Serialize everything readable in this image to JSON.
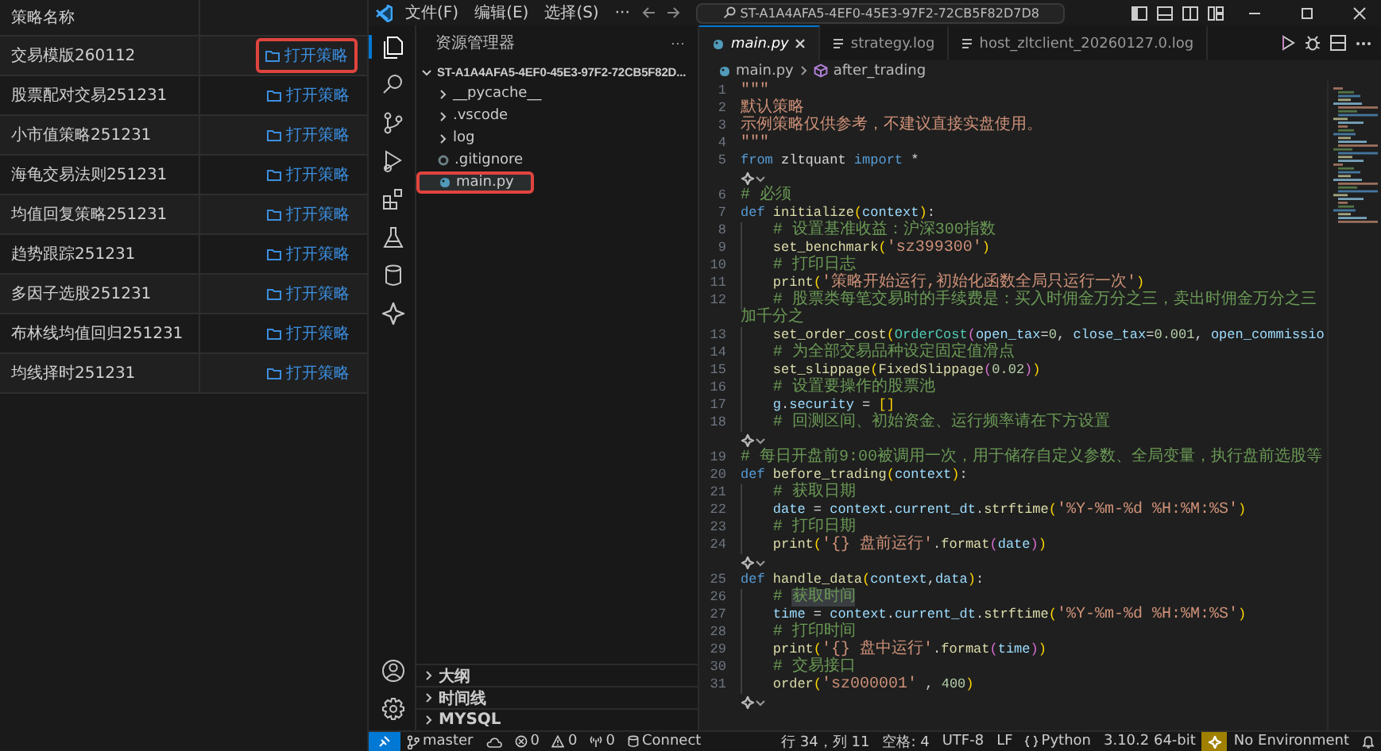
{
  "strategy_list": {
    "header": "策略名称",
    "rows": [
      {
        "name": "交易模版260112",
        "action": "打开策略",
        "highlighted": true
      },
      {
        "name": "股票配对交易251231",
        "action": "打开策略",
        "highlighted": false
      },
      {
        "name": "小市值策略251231",
        "action": "打开策略",
        "highlighted": false
      },
      {
        "name": "海龟交易法则251231",
        "action": "打开策略",
        "highlighted": false
      },
      {
        "name": "均值回复策略251231",
        "action": "打开策略",
        "highlighted": false
      },
      {
        "name": "趋势跟踪251231",
        "action": "打开策略",
        "highlighted": false
      },
      {
        "name": "多因子选股251231",
        "action": "打开策略",
        "highlighted": false
      },
      {
        "name": "布林线均值回归251231",
        "action": "打开策略",
        "highlighted": false
      },
      {
        "name": "均线择时251231",
        "action": "打开策略",
        "highlighted": false
      }
    ]
  },
  "title_bar": {
    "menus": [
      "文件(F)",
      "编辑(E)",
      "选择(S)",
      "···"
    ],
    "search": "ST-A1A4AFA5-4EF0-45E3-97F2-72CB5F82D7D8"
  },
  "activity_bar": [
    {
      "kind": "files",
      "selected": true
    },
    {
      "kind": "search",
      "selected": false
    },
    {
      "kind": "scm",
      "selected": false
    },
    {
      "kind": "debug",
      "selected": false
    },
    {
      "kind": "extensions",
      "selected": false
    },
    {
      "kind": "testing",
      "selected": false
    },
    {
      "kind": "database",
      "selected": false
    },
    {
      "kind": "star",
      "selected": false
    },
    {
      "kind": "account",
      "selected": false
    },
    {
      "kind": "settings",
      "selected": false
    }
  ],
  "explorer": {
    "title": "资源管理器",
    "more": "···",
    "root": {
      "label": "ST-A1A4AFA5-4EF0-45E3-97F2-72CB5F82D...",
      "expanded": true,
      "children": [
        {
          "kind": "folder",
          "label": "__pycache__",
          "expanded": false,
          "selected": false,
          "highlighted": false
        },
        {
          "kind": "folder",
          "label": ".vscode",
          "expanded": false,
          "selected": false,
          "highlighted": false
        },
        {
          "kind": "folder",
          "label": "log",
          "expanded": false,
          "selected": false,
          "highlighted": false
        },
        {
          "kind": "file",
          "label": ".gitignore",
          "selected": false,
          "highlighted": false
        },
        {
          "kind": "file",
          "label": "main.py",
          "selected": true,
          "highlighted": true
        }
      ]
    },
    "sections": [
      {
        "label": "大纲",
        "expanded": false
      },
      {
        "label": "时间线",
        "expanded": false
      },
      {
        "label": "MYSQL",
        "expanded": false
      }
    ]
  },
  "tabs": [
    {
      "label": "main.py",
      "selected": true,
      "kind": "python"
    },
    {
      "label": "strategy.log",
      "selected": false,
      "kind": "log"
    },
    {
      "label": "host_zltclient_20260127.0.log",
      "selected": false,
      "kind": "log"
    }
  ],
  "breadcrumb": [
    "main.py",
    "after_trading"
  ],
  "code": [
    {
      "number": "1",
      "indented": false,
      "tokens": [
        {
          "kind": "str",
          "text": "\"\"\""
        }
      ]
    },
    {
      "number": "2",
      "indented": false,
      "tokens": [
        {
          "kind": "str",
          "text": "默认策略"
        }
      ]
    },
    {
      "number": "3",
      "indented": false,
      "tokens": [
        {
          "kind": "str",
          "text": "示例策略仅供参考，不建议直接实盘使用。"
        }
      ]
    },
    {
      "number": "4",
      "indented": false,
      "tokens": [
        {
          "kind": "str",
          "text": "\"\"\""
        }
      ]
    },
    {
      "number": "5",
      "indented": false,
      "tokens": [
        {
          "kind": "kw",
          "text": "from"
        },
        {
          "kind": "plain",
          "text": " zltquant "
        },
        {
          "kind": "kw",
          "text": "import"
        },
        {
          "kind": "plain",
          "text": " *"
        }
      ]
    },
    {
      "kind": "lens"
    },
    {
      "number": "6",
      "indented": false,
      "tokens": [
        {
          "kind": "cm",
          "text": "# 必须"
        }
      ]
    },
    {
      "number": "7",
      "indented": false,
      "tokens": [
        {
          "kind": "kw",
          "text": "def "
        },
        {
          "kind": "fn",
          "text": "initialize"
        },
        {
          "kind": "br1",
          "text": "("
        },
        {
          "kind": "param",
          "text": "context"
        },
        {
          "kind": "br1",
          "text": ")"
        },
        {
          "kind": "plain",
          "text": ":"
        }
      ]
    },
    {
      "number": "8",
      "indented": true,
      "tokens": [
        {
          "kind": "cm",
          "text": "# 设置基准收益：沪深300指数"
        }
      ]
    },
    {
      "number": "9",
      "indented": true,
      "tokens": [
        {
          "kind": "fn",
          "text": "set_benchmark"
        },
        {
          "kind": "br1",
          "text": "("
        },
        {
          "kind": "str",
          "text": "'sz399300'"
        },
        {
          "kind": "br1",
          "text": ")"
        }
      ]
    },
    {
      "number": "10",
      "indented": true,
      "tokens": [
        {
          "kind": "cm",
          "text": "# 打印日志"
        }
      ]
    },
    {
      "number": "11",
      "indented": true,
      "tokens": [
        {
          "kind": "fn",
          "text": "print"
        },
        {
          "kind": "br1",
          "text": "("
        },
        {
          "kind": "str",
          "text": "'策略开始运行,初始化函数全局只运行一次'"
        },
        {
          "kind": "br1",
          "text": ")"
        }
      ]
    },
    {
      "number": "12",
      "indented": true,
      "tokens": [
        {
          "kind": "cm",
          "text": "# 股票类每笔交易时的手续费是：买入时佣金万分之三，卖出时佣金万分之三加千分之"
        }
      ]
    },
    {
      "number": "13",
      "indented": true,
      "tokens": [
        {
          "kind": "fn",
          "text": "set_order_cost"
        },
        {
          "kind": "br1",
          "text": "("
        },
        {
          "kind": "cls",
          "text": "OrderCost"
        },
        {
          "kind": "br2",
          "text": "("
        },
        {
          "kind": "param",
          "text": "open_tax"
        },
        {
          "kind": "plain",
          "text": "="
        },
        {
          "kind": "num",
          "text": "0"
        },
        {
          "kind": "plain",
          "text": ", "
        },
        {
          "kind": "param",
          "text": "close_tax"
        },
        {
          "kind": "plain",
          "text": "="
        },
        {
          "kind": "num",
          "text": "0.001"
        },
        {
          "kind": "plain",
          "text": ", "
        },
        {
          "kind": "param",
          "text": "open_commissio"
        }
      ]
    },
    {
      "number": "14",
      "indented": true,
      "tokens": [
        {
          "kind": "cm",
          "text": "# 为全部交易品种设定固定值滑点"
        }
      ]
    },
    {
      "number": "15",
      "indented": true,
      "tokens": [
        {
          "kind": "fn",
          "text": "set_slippage"
        },
        {
          "kind": "br1",
          "text": "("
        },
        {
          "kind": "fn",
          "text": "FixedSlippage"
        },
        {
          "kind": "br2",
          "text": "("
        },
        {
          "kind": "num",
          "text": "0.02"
        },
        {
          "kind": "br2",
          "text": ")"
        },
        {
          "kind": "br1",
          "text": ")"
        }
      ]
    },
    {
      "number": "16",
      "indented": true,
      "tokens": [
        {
          "kind": "cm",
          "text": "# 设置要操作的股票池"
        }
      ]
    },
    {
      "number": "17",
      "indented": true,
      "tokens": [
        {
          "kind": "var",
          "text": "g"
        },
        {
          "kind": "plain",
          "text": "."
        },
        {
          "kind": "var",
          "text": "security"
        },
        {
          "kind": "plain",
          "text": " = "
        },
        {
          "kind": "br1",
          "text": "[]"
        }
      ]
    },
    {
      "number": "18",
      "indented": true,
      "tokens": [
        {
          "kind": "cm",
          "text": "# 回测区间、初始资金、运行频率请在下方设置"
        }
      ]
    },
    {
      "kind": "lens"
    },
    {
      "number": "19",
      "indented": false,
      "tokens": [
        {
          "kind": "cm",
          "text": "# 每日开盘前9:00被调用一次，用于储存自定义参数、全局变量，执行盘前选股等"
        }
      ]
    },
    {
      "number": "20",
      "indented": false,
      "tokens": [
        {
          "kind": "kw",
          "text": "def "
        },
        {
          "kind": "fn",
          "text": "before_trading"
        },
        {
          "kind": "br1",
          "text": "("
        },
        {
          "kind": "param",
          "text": "context"
        },
        {
          "kind": "br1",
          "text": ")"
        },
        {
          "kind": "plain",
          "text": ":"
        }
      ]
    },
    {
      "number": "21",
      "indented": true,
      "tokens": [
        {
          "kind": "cm",
          "text": "# 获取日期"
        }
      ]
    },
    {
      "number": "22",
      "indented": true,
      "tokens": [
        {
          "kind": "var",
          "text": "date"
        },
        {
          "kind": "plain",
          "text": " = "
        },
        {
          "kind": "var",
          "text": "context"
        },
        {
          "kind": "plain",
          "text": "."
        },
        {
          "kind": "var",
          "text": "current_dt"
        },
        {
          "kind": "plain",
          "text": "."
        },
        {
          "kind": "fn",
          "text": "strftime"
        },
        {
          "kind": "br1",
          "text": "("
        },
        {
          "kind": "str",
          "text": "'%Y-%m-%d %H:%M:%S'"
        },
        {
          "kind": "br1",
          "text": ")"
        }
      ]
    },
    {
      "number": "23",
      "indented": true,
      "tokens": [
        {
          "kind": "cm",
          "text": "# 打印日期"
        }
      ]
    },
    {
      "number": "24",
      "indented": true,
      "tokens": [
        {
          "kind": "fn",
          "text": "print"
        },
        {
          "kind": "br1",
          "text": "("
        },
        {
          "kind": "str",
          "text": "'{} 盘前运行'"
        },
        {
          "kind": "plain",
          "text": "."
        },
        {
          "kind": "fn",
          "text": "format"
        },
        {
          "kind": "br2",
          "text": "("
        },
        {
          "kind": "var",
          "text": "date"
        },
        {
          "kind": "br2",
          "text": ")"
        },
        {
          "kind": "br1",
          "text": ")"
        }
      ]
    },
    {
      "kind": "lens"
    },
    {
      "number": "25",
      "indented": false,
      "tokens": [
        {
          "kind": "kw",
          "text": "def "
        },
        {
          "kind": "fn",
          "text": "handle_data"
        },
        {
          "kind": "br1",
          "text": "("
        },
        {
          "kind": "param",
          "text": "context"
        },
        {
          "kind": "plain",
          "text": ","
        },
        {
          "kind": "param",
          "text": "data"
        },
        {
          "kind": "br1",
          "text": ")"
        },
        {
          "kind": "plain",
          "text": ":"
        }
      ]
    },
    {
      "number": "26",
      "indented": true,
      "tokens": [
        {
          "kind": "cm",
          "text": "#"
        },
        {
          "kind": "cm-hl",
          "text": "获取时间"
        }
      ]
    },
    {
      "number": "27",
      "indented": true,
      "tokens": [
        {
          "kind": "var",
          "text": "time"
        },
        {
          "kind": "plain",
          "text": " = "
        },
        {
          "kind": "var",
          "text": "context"
        },
        {
          "kind": "plain",
          "text": "."
        },
        {
          "kind": "var",
          "text": "current_dt"
        },
        {
          "kind": "plain",
          "text": "."
        },
        {
          "kind": "fn",
          "text": "strftime"
        },
        {
          "kind": "br1",
          "text": "("
        },
        {
          "kind": "str",
          "text": "'%Y-%m-%d %H:%M:%S'"
        },
        {
          "kind": "br1",
          "text": ")"
        }
      ]
    },
    {
      "number": "28",
      "indented": true,
      "tokens": [
        {
          "kind": "cm",
          "text": "# 打印时间"
        }
      ]
    },
    {
      "number": "29",
      "indented": true,
      "tokens": [
        {
          "kind": "fn",
          "text": "print"
        },
        {
          "kind": "br1",
          "text": "("
        },
        {
          "kind": "str",
          "text": "'{} 盘中运行'"
        },
        {
          "kind": "plain",
          "text": "."
        },
        {
          "kind": "fn",
          "text": "format"
        },
        {
          "kind": "br2",
          "text": "("
        },
        {
          "kind": "var",
          "text": "time"
        },
        {
          "kind": "br2",
          "text": ")"
        },
        {
          "kind": "br1",
          "text": ")"
        }
      ]
    },
    {
      "number": "30",
      "indented": true,
      "tokens": [
        {
          "kind": "cm",
          "text": "# 交易接口"
        }
      ]
    },
    {
      "number": "31",
      "indented": true,
      "tokens": [
        {
          "kind": "fn",
          "text": "order"
        },
        {
          "kind": "br1",
          "text": "("
        },
        {
          "kind": "str",
          "text": "'sz000001'"
        },
        {
          "kind": "plain",
          "text": " , "
        },
        {
          "kind": "num",
          "text": "400"
        },
        {
          "kind": "br1",
          "text": ")"
        }
      ]
    },
    {
      "kind": "lens"
    }
  ],
  "status_bar": {
    "left": [
      {
        "kind": "remote"
      },
      {
        "kind": "branch",
        "text": "master"
      },
      {
        "kind": "sync"
      },
      {
        "kind": "errors",
        "text": "0"
      },
      {
        "kind": "warnings",
        "text": "0"
      },
      {
        "kind": "ports",
        "text": "0"
      },
      {
        "kind": "database",
        "text": "Connect"
      }
    ],
    "right": [
      {
        "kind": "text",
        "text": "行 34，列 11"
      },
      {
        "kind": "text",
        "text": "空格: 4"
      },
      {
        "kind": "text",
        "text": "UTF-8"
      },
      {
        "kind": "text",
        "text": "LF"
      },
      {
        "kind": "language",
        "text": "Python"
      },
      {
        "kind": "text",
        "text": "3.10.2 64-bit"
      },
      {
        "kind": "extension"
      },
      {
        "kind": "text",
        "text": "No Environment"
      },
      {
        "kind": "bell"
      }
    ]
  }
}
